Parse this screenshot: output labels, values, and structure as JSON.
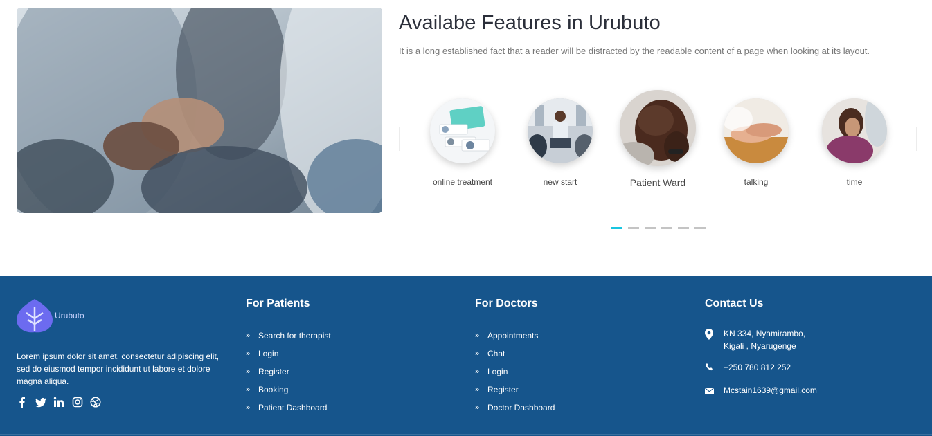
{
  "features": {
    "title": "Availabe Features in Urubuto",
    "description": "It is a long established fact that a reader will be distracted by the readable content of a page when looking at its layout.",
    "items": [
      {
        "label": "online treatment",
        "image": "online-treatment-image"
      },
      {
        "label": "new start",
        "image": "new-start-image"
      },
      {
        "label": "Patient Ward",
        "image": "patient-ward-image",
        "active": true
      },
      {
        "label": "talking",
        "image": "talking-image"
      },
      {
        "label": "time",
        "image": "time-image"
      }
    ],
    "carousel_pages": 6,
    "carousel_current": 1,
    "accent_color": "#19c5e0"
  },
  "footer": {
    "background": "#16558c",
    "brand": "Urubuto",
    "about": "Lorem ipsum dolor sit amet, consectetur adipiscing elit, sed do eiusmod tempor incididunt ut labore et dolore magna aliqua.",
    "socials": [
      "facebook-icon",
      "twitter-icon",
      "linkedin-icon",
      "instagram-icon",
      "dribbble-icon"
    ],
    "patients": {
      "title": "For Patients",
      "links": [
        "Search for therapist",
        "Login",
        "Register",
        "Booking",
        "Patient Dashboard"
      ]
    },
    "doctors": {
      "title": "For Doctors",
      "links": [
        "Appointments",
        "Chat",
        "Login",
        "Register",
        "Doctor Dashboard"
      ]
    },
    "contact": {
      "title": "Contact Us",
      "address_line1": "KN 334, Nyamirambo,",
      "address_line2": "Kigali , Nyarugenge",
      "phone": "+250 780 812 252",
      "email": "Mcstain1639@gmail.com"
    }
  }
}
